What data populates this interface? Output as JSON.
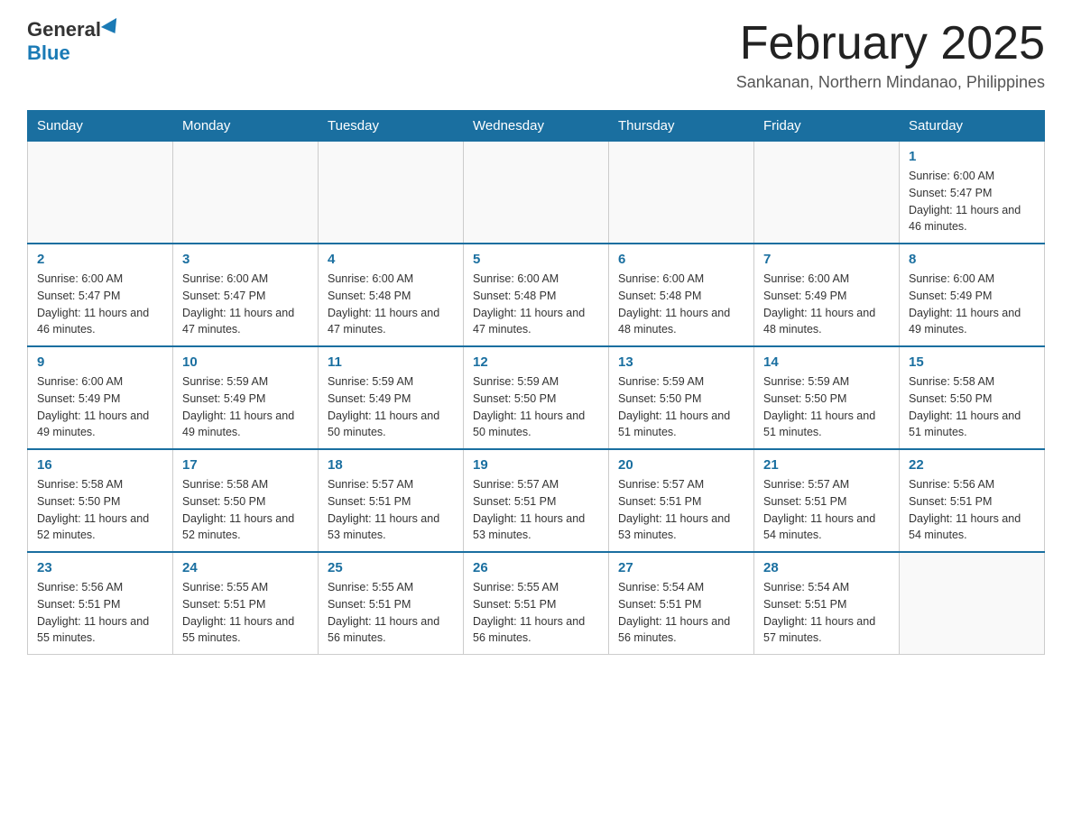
{
  "header": {
    "logo_general": "General",
    "logo_blue": "Blue",
    "month_title": "February 2025",
    "location": "Sankanan, Northern Mindanao, Philippines"
  },
  "days_of_week": [
    "Sunday",
    "Monday",
    "Tuesday",
    "Wednesday",
    "Thursday",
    "Friday",
    "Saturday"
  ],
  "weeks": [
    {
      "days": [
        {
          "number": "",
          "info": ""
        },
        {
          "number": "",
          "info": ""
        },
        {
          "number": "",
          "info": ""
        },
        {
          "number": "",
          "info": ""
        },
        {
          "number": "",
          "info": ""
        },
        {
          "number": "",
          "info": ""
        },
        {
          "number": "1",
          "info": "Sunrise: 6:00 AM\nSunset: 5:47 PM\nDaylight: 11 hours and 46 minutes."
        }
      ]
    },
    {
      "days": [
        {
          "number": "2",
          "info": "Sunrise: 6:00 AM\nSunset: 5:47 PM\nDaylight: 11 hours and 46 minutes."
        },
        {
          "number": "3",
          "info": "Sunrise: 6:00 AM\nSunset: 5:47 PM\nDaylight: 11 hours and 47 minutes."
        },
        {
          "number": "4",
          "info": "Sunrise: 6:00 AM\nSunset: 5:48 PM\nDaylight: 11 hours and 47 minutes."
        },
        {
          "number": "5",
          "info": "Sunrise: 6:00 AM\nSunset: 5:48 PM\nDaylight: 11 hours and 47 minutes."
        },
        {
          "number": "6",
          "info": "Sunrise: 6:00 AM\nSunset: 5:48 PM\nDaylight: 11 hours and 48 minutes."
        },
        {
          "number": "7",
          "info": "Sunrise: 6:00 AM\nSunset: 5:49 PM\nDaylight: 11 hours and 48 minutes."
        },
        {
          "number": "8",
          "info": "Sunrise: 6:00 AM\nSunset: 5:49 PM\nDaylight: 11 hours and 49 minutes."
        }
      ]
    },
    {
      "days": [
        {
          "number": "9",
          "info": "Sunrise: 6:00 AM\nSunset: 5:49 PM\nDaylight: 11 hours and 49 minutes."
        },
        {
          "number": "10",
          "info": "Sunrise: 5:59 AM\nSunset: 5:49 PM\nDaylight: 11 hours and 49 minutes."
        },
        {
          "number": "11",
          "info": "Sunrise: 5:59 AM\nSunset: 5:49 PM\nDaylight: 11 hours and 50 minutes."
        },
        {
          "number": "12",
          "info": "Sunrise: 5:59 AM\nSunset: 5:50 PM\nDaylight: 11 hours and 50 minutes."
        },
        {
          "number": "13",
          "info": "Sunrise: 5:59 AM\nSunset: 5:50 PM\nDaylight: 11 hours and 51 minutes."
        },
        {
          "number": "14",
          "info": "Sunrise: 5:59 AM\nSunset: 5:50 PM\nDaylight: 11 hours and 51 minutes."
        },
        {
          "number": "15",
          "info": "Sunrise: 5:58 AM\nSunset: 5:50 PM\nDaylight: 11 hours and 51 minutes."
        }
      ]
    },
    {
      "days": [
        {
          "number": "16",
          "info": "Sunrise: 5:58 AM\nSunset: 5:50 PM\nDaylight: 11 hours and 52 minutes."
        },
        {
          "number": "17",
          "info": "Sunrise: 5:58 AM\nSunset: 5:50 PM\nDaylight: 11 hours and 52 minutes."
        },
        {
          "number": "18",
          "info": "Sunrise: 5:57 AM\nSunset: 5:51 PM\nDaylight: 11 hours and 53 minutes."
        },
        {
          "number": "19",
          "info": "Sunrise: 5:57 AM\nSunset: 5:51 PM\nDaylight: 11 hours and 53 minutes."
        },
        {
          "number": "20",
          "info": "Sunrise: 5:57 AM\nSunset: 5:51 PM\nDaylight: 11 hours and 53 minutes."
        },
        {
          "number": "21",
          "info": "Sunrise: 5:57 AM\nSunset: 5:51 PM\nDaylight: 11 hours and 54 minutes."
        },
        {
          "number": "22",
          "info": "Sunrise: 5:56 AM\nSunset: 5:51 PM\nDaylight: 11 hours and 54 minutes."
        }
      ]
    },
    {
      "days": [
        {
          "number": "23",
          "info": "Sunrise: 5:56 AM\nSunset: 5:51 PM\nDaylight: 11 hours and 55 minutes."
        },
        {
          "number": "24",
          "info": "Sunrise: 5:55 AM\nSunset: 5:51 PM\nDaylight: 11 hours and 55 minutes."
        },
        {
          "number": "25",
          "info": "Sunrise: 5:55 AM\nSunset: 5:51 PM\nDaylight: 11 hours and 56 minutes."
        },
        {
          "number": "26",
          "info": "Sunrise: 5:55 AM\nSunset: 5:51 PM\nDaylight: 11 hours and 56 minutes."
        },
        {
          "number": "27",
          "info": "Sunrise: 5:54 AM\nSunset: 5:51 PM\nDaylight: 11 hours and 56 minutes."
        },
        {
          "number": "28",
          "info": "Sunrise: 5:54 AM\nSunset: 5:51 PM\nDaylight: 11 hours and 57 minutes."
        },
        {
          "number": "",
          "info": ""
        }
      ]
    }
  ]
}
